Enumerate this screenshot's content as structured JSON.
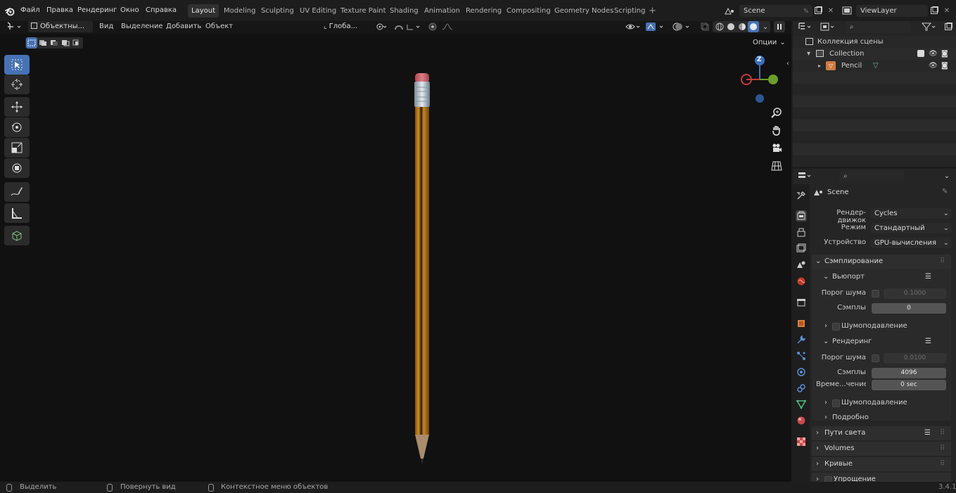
{
  "topbar": {
    "menus": [
      "Файл",
      "Правка",
      "Рендеринг",
      "Окно",
      "Справка"
    ],
    "workspaces": [
      {
        "label": "Layout",
        "active": true
      },
      {
        "label": "Modeling",
        "active": false
      },
      {
        "label": "Sculpting",
        "active": false
      },
      {
        "label": "UV Editing",
        "active": false
      },
      {
        "label": "Texture Paint",
        "active": false
      },
      {
        "label": "Shading",
        "active": false
      },
      {
        "label": "Animation",
        "active": false
      },
      {
        "label": "Rendering",
        "active": false
      },
      {
        "label": "Compositing",
        "active": false
      },
      {
        "label": "Geometry Nodes",
        "active": false
      },
      {
        "label": "Scripting",
        "active": false
      }
    ],
    "add_workspace": "+",
    "scene_name": "Scene",
    "view_layer": "ViewLayer"
  },
  "viewport_header": {
    "mode": "Объектны...",
    "menus": [
      "Вид",
      "Выделение",
      "Добавить",
      "Объект"
    ],
    "transform_orientation": "Глоба...",
    "options": "Опции"
  },
  "gizmo": {
    "z_label": "Z"
  },
  "outliner": {
    "scene_collection": "Коллекция сцены",
    "collection": "Collection",
    "object": "Pencil"
  },
  "properties": {
    "context": "Scene",
    "render_engine": {
      "label": "Рендер-движок",
      "value": "Cycles"
    },
    "feature_set": {
      "label": "Режим",
      "value": "Стандартный"
    },
    "device": {
      "label": "Устройство",
      "value": "GPU-вычисления"
    },
    "sampling": {
      "title": "Сэмплирование",
      "viewport": {
        "title": "Вьюпорт",
        "noise_threshold": {
          "label": "Порог шума",
          "value": "0.1000"
        },
        "samples": {
          "label": "Сэмплы",
          "value": "0"
        },
        "denoise": "Шумоподавление"
      },
      "render": {
        "title": "Рендеринг",
        "noise_threshold": {
          "label": "Порог шума",
          "value": "0.0100"
        },
        "samples": {
          "label": "Сэмплы",
          "value": "4096"
        },
        "time_limit": {
          "label": "Време...чениеё",
          "value": "0 sec"
        },
        "denoise": "Шумоподавление"
      },
      "advanced": "Подробно"
    },
    "light_paths": "Пути света",
    "volumes": "Volumes",
    "curves": "Кривые",
    "simplify": "Упрощение"
  },
  "statusbar": {
    "select": "Выделить",
    "rotate_view": "Повернуть вид",
    "context_menu": "Контекстное меню объектов",
    "version": "3.4.1"
  },
  "colors": {
    "accent": "#4772b3",
    "viewport_bg": "#111111",
    "pencil_body": "#d4901f",
    "eraser": "#e07d86",
    "axis_x": "#c8383e",
    "axis_y": "#6a9e2a",
    "axis_z": "#3c6fbf"
  }
}
